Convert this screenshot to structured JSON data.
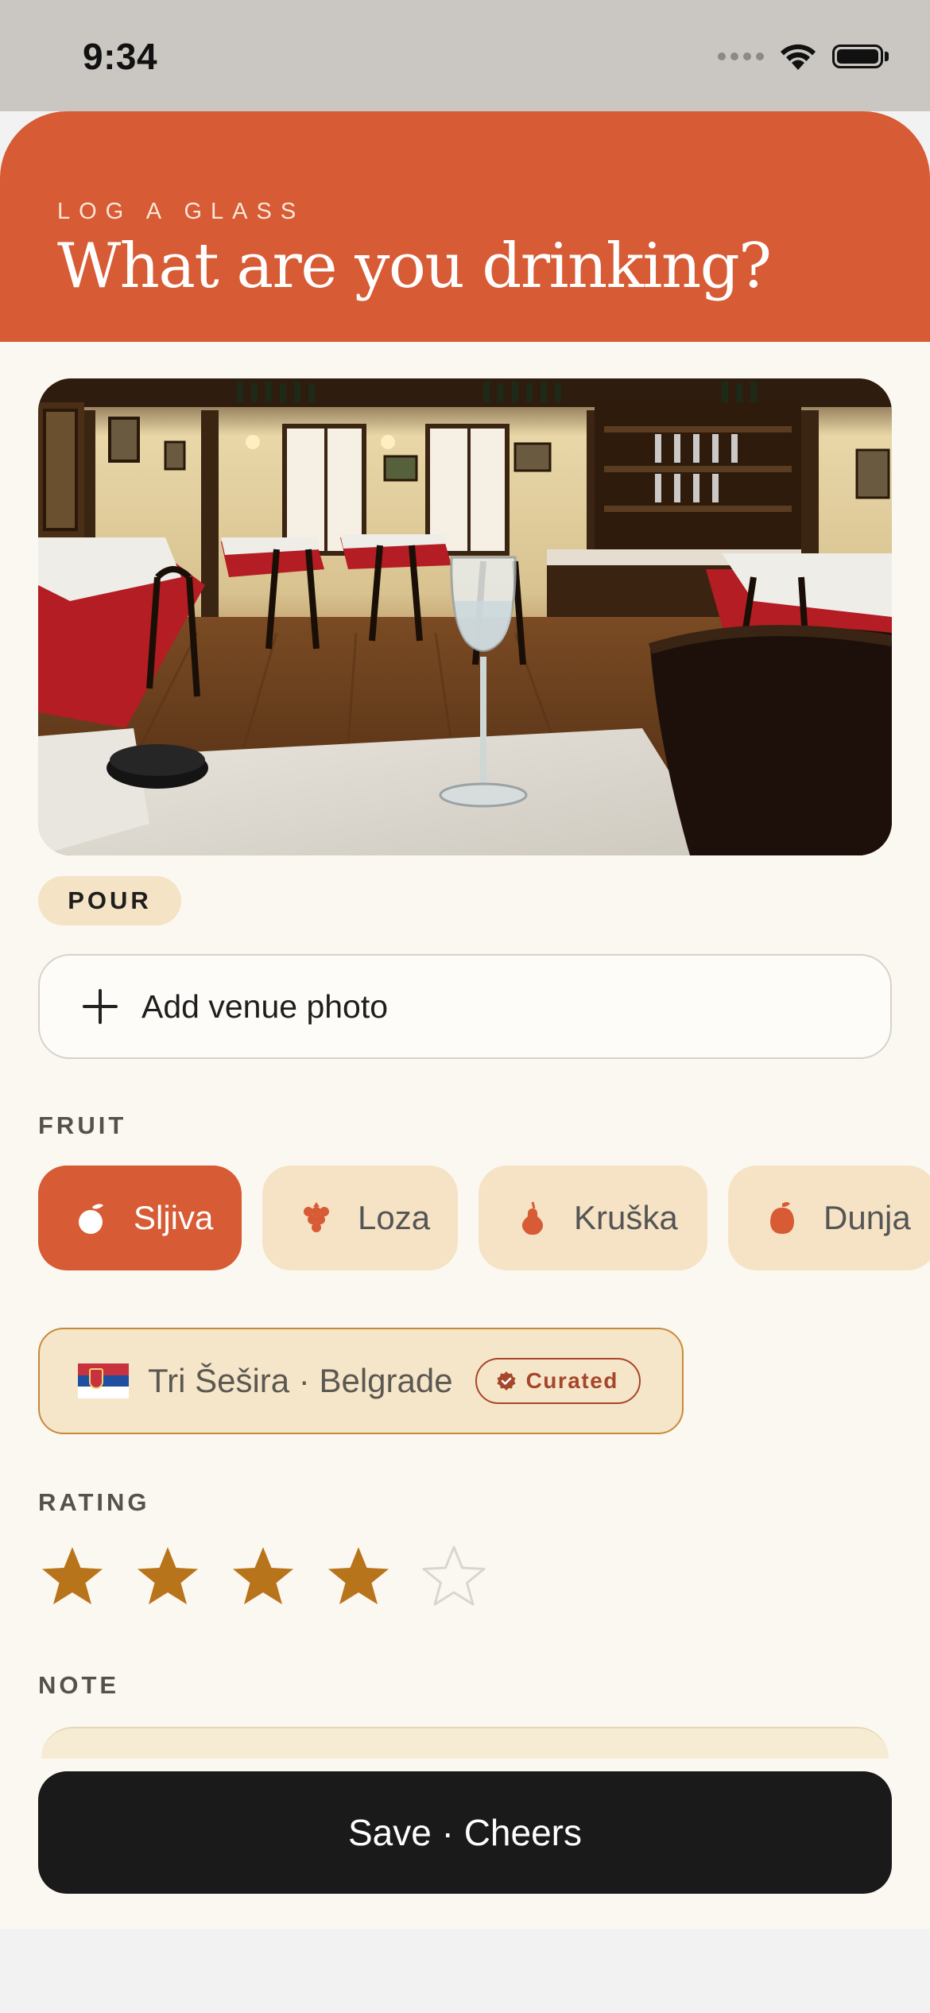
{
  "status": {
    "time": "9:34"
  },
  "header": {
    "eyebrow": "LOG A GLASS",
    "title": "What are you drinking?"
  },
  "pour_tag": "POUR",
  "add_photo": {
    "label": "Add venue photo"
  },
  "fruit": {
    "label": "FRUIT",
    "options": [
      {
        "label": "Sljiva",
        "icon": "plum-icon",
        "selected": true
      },
      {
        "label": "Loza",
        "icon": "grape-icon",
        "selected": false
      },
      {
        "label": "Kruška",
        "icon": "pear-icon",
        "selected": false
      },
      {
        "label": "Dunja",
        "icon": "quince-icon",
        "selected": false
      }
    ]
  },
  "venue": {
    "name": "Tri Šešira · Belgrade",
    "badge": "Curated",
    "flag": "serbia-flag-icon"
  },
  "rating": {
    "label": "RATING",
    "value": 4,
    "max": 5
  },
  "note": {
    "label": "NOTE"
  },
  "save_button": "Save · Cheers",
  "colors": {
    "accent": "#d75b34",
    "star": "#b8741a",
    "chip": "#f6e3c6",
    "background": "#fbf8f1"
  }
}
